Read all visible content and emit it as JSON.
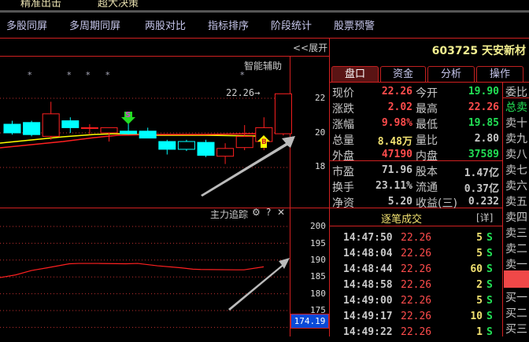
{
  "top_strip": [
    "精准出击",
    "超大决策"
  ],
  "menu": [
    "多股同屏",
    "多周期同屏",
    "两股对比",
    "指标排序",
    "阶段统计",
    "股票预警"
  ],
  "expand_label": "<<展开",
  "main_chart": {
    "assist_label": "智能辅助",
    "price_marker": "22.26→",
    "y_ticks": [
      "22",
      "20",
      "18"
    ],
    "sell_marker": "S",
    "buy_marker": "B",
    "candles": [
      {
        "o": 20.5,
        "c": 20.0,
        "h": 20.7,
        "l": 19.9
      },
      {
        "o": 20.6,
        "c": 19.9,
        "h": 20.7,
        "l": 19.8
      },
      {
        "o": 19.8,
        "c": 21.1,
        "h": 21.8,
        "l": 19.6
      },
      {
        "o": 20.7,
        "c": 20.3,
        "h": 20.9,
        "l": 20.0
      },
      {
        "o": 20.3,
        "c": 20.3,
        "h": 20.5,
        "l": 19.9
      },
      {
        "o": 20.0,
        "c": 20.3,
        "h": 20.3,
        "l": 19.5
      },
      {
        "o": 20.1,
        "c": 19.95,
        "h": 20.6,
        "l": 19.9
      },
      {
        "o": 20.1,
        "c": 19.7,
        "h": 20.3,
        "l": 19.7
      },
      {
        "o": 19.5,
        "c": 19.05,
        "h": 19.6,
        "l": 18.75
      },
      {
        "o": 19.5,
        "c": 19.05,
        "h": 19.6,
        "l": 18.95
      },
      {
        "o": 19.45,
        "c": 18.7,
        "h": 19.6,
        "l": 18.6
      },
      {
        "o": 18.65,
        "c": 19.1,
        "h": 19.4,
        "l": 18.2
      },
      {
        "o": 19.15,
        "c": 19.8,
        "h": 20.45,
        "l": 19.0
      },
      {
        "o": 19.5,
        "c": 20.3,
        "h": 20.9,
        "l": 19.0
      },
      {
        "o": 19.95,
        "c": 22.26,
        "h": 22.26,
        "l": 19.85
      }
    ],
    "candle_colors": {
      "up": "#ff2020",
      "down": "#00ffff"
    }
  },
  "indicator": {
    "title": "主力追踪",
    "y_ticks": [
      "200",
      "195",
      "190",
      "185",
      "180",
      "175"
    ],
    "current_value": "174.19",
    "series": [
      [
        0,
        184.8
      ],
      [
        20,
        185.6
      ],
      [
        40,
        186.9
      ],
      [
        60,
        187.7
      ],
      [
        88,
        188.9
      ],
      [
        100,
        189.0
      ],
      [
        125,
        189.0
      ],
      [
        160,
        188.9
      ],
      [
        175,
        189.0
      ],
      [
        200,
        188.3
      ],
      [
        230,
        187.7
      ],
      [
        245,
        187.3
      ],
      [
        255,
        187.2
      ],
      [
        300,
        187.1
      ],
      [
        310,
        187.1
      ],
      [
        335,
        188.0
      ]
    ]
  },
  "stock": {
    "code_name": "603725 天安新材"
  },
  "tabs": [
    "盘口",
    "资金",
    "分析",
    "操作"
  ],
  "quote_rows": [
    {
      "l1": "现价",
      "v1": "22.26",
      "c1": "r",
      "l2": "今开",
      "v2": "19.90",
      "c2": "g"
    },
    {
      "l1": "涨跌",
      "v1": "2.02",
      "c1": "r",
      "l2": "最高",
      "v2": "22.26",
      "c2": "r"
    },
    {
      "l1": "涨幅",
      "v1": "9.98%",
      "c1": "r",
      "l2": "最低",
      "v2": "19.85",
      "c2": "g"
    },
    {
      "l1": "总量",
      "v1": "8.48万",
      "c1": "y",
      "l2": "量比",
      "v2": "2.80",
      "c2": "w"
    },
    {
      "l1": "外盘",
      "v1": "47190",
      "c1": "r",
      "l2": "内盘",
      "v2": "37589",
      "c2": "g"
    }
  ],
  "fund_rows": [
    {
      "l1": "市盈",
      "v1": "71.96",
      "l2": "股本",
      "v2": "1.47亿"
    },
    {
      "l1": "换手",
      "v1": "23.11%",
      "l2": "流通",
      "v2": "0.37亿"
    },
    {
      "l1": "净资",
      "v1": "5.20",
      "l2": "收益(三)",
      "v2": "0.232"
    }
  ],
  "trades_title": "逐笔成交",
  "trades_detail": "[详]",
  "trades": [
    {
      "time": "14:47:50",
      "price": "22.26",
      "vol": "5",
      "side": "S"
    },
    {
      "time": "14:48:04",
      "price": "22.26",
      "vol": "5",
      "side": "S"
    },
    {
      "time": "14:48:44",
      "price": "22.26",
      "vol": "60",
      "side": "S"
    },
    {
      "time": "14:48:58",
      "price": "22.26",
      "vol": "2",
      "side": "S"
    },
    {
      "time": "14:49:00",
      "price": "22.26",
      "vol": "5",
      "side": "S"
    },
    {
      "time": "14:49:17",
      "price": "22.26",
      "vol": "10",
      "side": "S"
    },
    {
      "time": "14:49:22",
      "price": "22.26",
      "vol": "1",
      "side": "S"
    }
  ],
  "order_book": {
    "ratio": "委比",
    "total_sell": "总卖",
    "sell": [
      "卖十",
      "卖九",
      "卖八",
      "卖七",
      "卖六",
      "卖五",
      "卖四",
      "卖三",
      "卖二",
      "卖一"
    ],
    "buy": [
      "买一",
      "买二",
      "买三"
    ]
  }
}
